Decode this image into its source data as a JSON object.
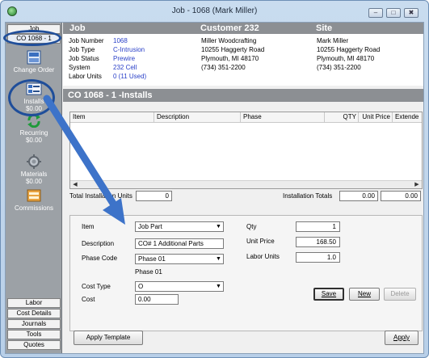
{
  "window": {
    "title": "Job - 1068 (Mark Miller)",
    "minimize": "‒",
    "maximize": "□",
    "close": "✖"
  },
  "nav": {
    "tab_job": "Job",
    "tab_co": "CO 1068 - 1",
    "items": [
      {
        "label": "Change Order",
        "sub": "",
        "icon": "change-order-icon"
      },
      {
        "label": "Installs",
        "sub": "$0.00",
        "icon": "installs-icon"
      },
      {
        "label": "Recurring",
        "sub": "$0.00",
        "icon": "recurring-icon"
      },
      {
        "label": "Materials",
        "sub": "$0.00",
        "icon": "materials-icon"
      },
      {
        "label": "Commissions",
        "sub": "",
        "icon": "commissions-icon"
      }
    ],
    "bottom": [
      "Labor",
      "Cost Details",
      "Journals",
      "Tools",
      "Quotes"
    ]
  },
  "header": {
    "job_title": "Job",
    "customer_title": "Customer 232",
    "site_title": "Site"
  },
  "job": {
    "labels": [
      "Job Number",
      "Job Type",
      "Job Status",
      "System",
      "Labor Units"
    ],
    "values": [
      "1068",
      "C-Intrusion",
      "Prewire",
      "232 Cell",
      "0 (11 Used)"
    ]
  },
  "customer": {
    "lines": [
      "Miller Woodcrafting",
      "10255 Haggerty Road",
      "Plymouth, MI  48170",
      "(734) 351-2200"
    ]
  },
  "site": {
    "lines": [
      "Mark Miller",
      "10255 Haggerty Road",
      "Plymouth, MI  48170",
      "(734) 351-2200"
    ]
  },
  "installs_title": "CO 1068 - 1 -Installs",
  "grid": {
    "columns": [
      "Item",
      "Description",
      "Phase",
      "QTY",
      "Unit Price",
      "Extende"
    ]
  },
  "totals": {
    "total_units_label": "Total Installation Units",
    "total_units_value": "0",
    "installation_totals_label": "Installation Totals",
    "installation_total_1": "0.00",
    "installation_total_2": "0.00"
  },
  "form": {
    "item_label": "Item",
    "item_value": "Job Part",
    "description_label": "Description",
    "description_value": "CO# 1 Additional Parts",
    "phase_code_label": "Phase Code",
    "phase_code_value": "Phase 01",
    "phase_text": "Phase 01",
    "cost_type_label": "Cost Type",
    "cost_type_value": "O",
    "cost_label": "Cost",
    "cost_value": "0.00",
    "qty_label": "Qty",
    "qty_value": "1",
    "unit_price_label": "Unit Price",
    "unit_price_value": "168.50",
    "labor_units_label": "Labor Units",
    "labor_units_value": "1.0",
    "save": "Save",
    "new": "New",
    "delete": "Delete"
  },
  "footer": {
    "apply_template": "Apply Template",
    "apply": "Apply"
  },
  "colors": {
    "accent_link": "#2a40c8",
    "band": "#8c8f93",
    "highlight": "#1f4e9a",
    "arrow": "#3d73c9"
  }
}
